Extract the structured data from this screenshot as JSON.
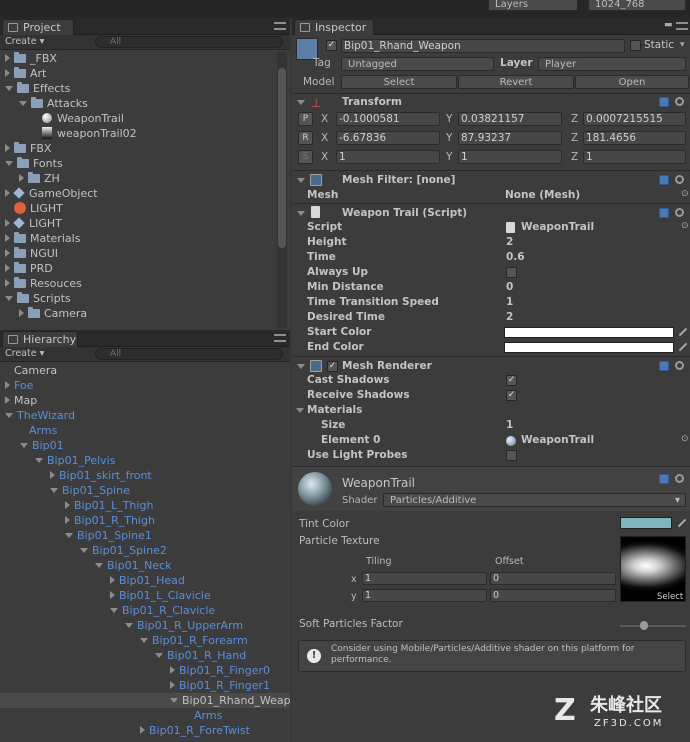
{
  "topbar": {
    "layers_label": "Layers",
    "layout_label": "1024_768"
  },
  "project": {
    "tab_label": "Project",
    "create_label": "Create ▾",
    "search_placeholder": "All",
    "items": [
      {
        "label": "_FBX",
        "depth": 0,
        "kind": "folder",
        "expand": "closed"
      },
      {
        "label": "Art",
        "depth": 0,
        "kind": "folder",
        "expand": "closed"
      },
      {
        "label": "Effects",
        "depth": 0,
        "kind": "folder",
        "expand": "open"
      },
      {
        "label": "Attacks",
        "depth": 1,
        "kind": "folder",
        "expand": "open"
      },
      {
        "label": "WeaponTrail",
        "depth": 2,
        "kind": "material",
        "expand": "none"
      },
      {
        "label": "weaponTrail02",
        "depth": 2,
        "kind": "texture",
        "expand": "none"
      },
      {
        "label": "FBX",
        "depth": 0,
        "kind": "folder",
        "expand": "closed"
      },
      {
        "label": "Fonts",
        "depth": 0,
        "kind": "folder",
        "expand": "open"
      },
      {
        "label": "ZH",
        "depth": 1,
        "kind": "folder",
        "expand": "closed"
      },
      {
        "label": "GameObject",
        "depth": 0,
        "kind": "prefab",
        "expand": "closed"
      },
      {
        "label": "LIGHT",
        "depth": 0,
        "kind": "lighticon",
        "expand": "none"
      },
      {
        "label": "LIGHT",
        "depth": 0,
        "kind": "prefab",
        "expand": "closed"
      },
      {
        "label": "Materials",
        "depth": 0,
        "kind": "folder",
        "expand": "closed"
      },
      {
        "label": "NGUI",
        "depth": 0,
        "kind": "folder",
        "expand": "closed"
      },
      {
        "label": "PRD",
        "depth": 0,
        "kind": "folder",
        "expand": "closed"
      },
      {
        "label": "Resouces",
        "depth": 0,
        "kind": "folder",
        "expand": "closed"
      },
      {
        "label": "Scripts",
        "depth": 0,
        "kind": "folder",
        "expand": "open"
      },
      {
        "label": "Camera",
        "depth": 1,
        "kind": "folder",
        "expand": "closed"
      }
    ]
  },
  "hierarchy": {
    "tab_label": "Hierarchy",
    "create_label": "Create ▾",
    "search_placeholder": "All",
    "items": [
      {
        "label": "Camera",
        "depth": 0,
        "expand": "none",
        "blue": false,
        "selected": false
      },
      {
        "label": "Foe",
        "depth": 0,
        "expand": "closed",
        "blue": true,
        "selected": false
      },
      {
        "label": "Map",
        "depth": 0,
        "expand": "closed",
        "blue": false,
        "selected": false
      },
      {
        "label": "TheWizard",
        "depth": 0,
        "expand": "open",
        "blue": true,
        "selected": false
      },
      {
        "label": "Arms",
        "depth": 1,
        "expand": "none",
        "blue": true,
        "selected": false
      },
      {
        "label": "Bip01",
        "depth": 1,
        "expand": "open",
        "blue": true,
        "selected": false
      },
      {
        "label": "Bip01_Pelvis",
        "depth": 2,
        "expand": "open",
        "blue": true,
        "selected": false
      },
      {
        "label": "Bip01_skirt_front",
        "depth": 3,
        "expand": "closed",
        "blue": true,
        "selected": false
      },
      {
        "label": "Bip01_Spine",
        "depth": 3,
        "expand": "open",
        "blue": true,
        "selected": false
      },
      {
        "label": "Bip01_L_Thigh",
        "depth": 4,
        "expand": "closed",
        "blue": true,
        "selected": false
      },
      {
        "label": "Bip01_R_Thigh",
        "depth": 4,
        "expand": "closed",
        "blue": true,
        "selected": false
      },
      {
        "label": "Bip01_Spine1",
        "depth": 4,
        "expand": "open",
        "blue": true,
        "selected": false
      },
      {
        "label": "Bip01_Spine2",
        "depth": 5,
        "expand": "open",
        "blue": true,
        "selected": false
      },
      {
        "label": "Bip01_Neck",
        "depth": 6,
        "expand": "open",
        "blue": true,
        "selected": false
      },
      {
        "label": "Bip01_Head",
        "depth": 7,
        "expand": "closed",
        "blue": true,
        "selected": false
      },
      {
        "label": "Bip01_L_Clavicle",
        "depth": 7,
        "expand": "closed",
        "blue": true,
        "selected": false
      },
      {
        "label": "Bip01_R_Clavicle",
        "depth": 7,
        "expand": "open",
        "blue": true,
        "selected": false
      },
      {
        "label": "Bip01_R_UpperArm",
        "depth": 8,
        "expand": "open",
        "blue": true,
        "selected": false
      },
      {
        "label": "Bip01_R_Forearm",
        "depth": 9,
        "expand": "open",
        "blue": true,
        "selected": false
      },
      {
        "label": "Bip01_R_Hand",
        "depth": 10,
        "expand": "open",
        "blue": true,
        "selected": false
      },
      {
        "label": "Bip01_R_Finger0",
        "depth": 11,
        "expand": "closed",
        "blue": true,
        "selected": false
      },
      {
        "label": "Bip01_R_Finger1",
        "depth": 11,
        "expand": "closed",
        "blue": true,
        "selected": false
      },
      {
        "label": "Bip01_Rhand_Weap",
        "depth": 11,
        "expand": "open",
        "blue": false,
        "selected": true
      },
      {
        "label": "Arms",
        "depth": 12,
        "expand": "none",
        "blue": true,
        "selected": false
      },
      {
        "label": "Bip01_R_ForeTwist",
        "depth": 9,
        "expand": "closed",
        "blue": true,
        "selected": false
      }
    ]
  },
  "inspector": {
    "tab_label": "Inspector",
    "object_name": "Bip01_Rhand_Weapon",
    "static_label": "Static",
    "tag_label": "Tag",
    "tag_value": "Untagged",
    "layer_label": "Layer",
    "layer_value": "Player",
    "model_label": "Model",
    "model_select": "Select",
    "model_revert": "Revert",
    "model_open": "Open",
    "transform": {
      "title": "Transform",
      "position": {
        "btn": "P",
        "x": "-0.1000581",
        "y": "0.03821157",
        "z": "0.0007215515"
      },
      "rotation": {
        "btn": "R",
        "x": "-6.67836",
        "y": "87.93237",
        "z": "181.4656"
      },
      "scale": {
        "btn": "S",
        "x": "1",
        "y": "1",
        "z": "1"
      },
      "x_label": "X",
      "y_label": "Y",
      "z_label": "Z"
    },
    "mesh_filter": {
      "title": "Mesh Filter: [none]",
      "mesh_label": "Mesh",
      "mesh_value": "None (Mesh)"
    },
    "weapon_trail": {
      "title": "Weapon Trail (Script)",
      "script_label": "Script",
      "script_value": "WeaponTrail",
      "height_label": "Height",
      "height_value": "2",
      "time_label": "Time",
      "time_value": "0.6",
      "always_up_label": "Always Up",
      "min_distance_label": "Min Distance",
      "min_distance_value": "0",
      "tts_label": "Time Transition Speed",
      "tts_value": "1",
      "desired_time_label": "Desired Time",
      "desired_time_value": "2",
      "start_color_label": "Start Color",
      "end_color_label": "End Color"
    },
    "mesh_renderer": {
      "title": "Mesh Renderer",
      "cast_shadows_label": "Cast Shadows",
      "receive_shadows_label": "Receive Shadows",
      "materials_label": "Materials",
      "size_label": "Size",
      "size_value": "1",
      "element0_label": "Element 0",
      "element0_value": "WeaponTrail",
      "light_probes_label": "Use Light Probes"
    },
    "material": {
      "name": "WeaponTrail",
      "shader_label": "Shader",
      "shader_value": "Particles/Additive",
      "tint_label": "Tint Color",
      "texture_label": "Particle Texture",
      "tiling_label": "Tiling",
      "offset_label": "Offset",
      "x_label": "x",
      "y_label": "y",
      "tiling_x": "1",
      "tiling_y": "1",
      "offset_x": "0",
      "offset_y": "0",
      "select_label": "Select",
      "soft_label": "Soft Particles Factor",
      "soft_value": 0.3,
      "info": "Consider using Mobile/Particles/Additive shader on this platform for performance."
    }
  },
  "watermark": {
    "brand": "朱峰社区",
    "url": "ZF3D.COM"
  },
  "colors": {
    "accent_blue": "#5b8fd6",
    "panel_bg": "#3c3c3c",
    "tint_color": "#7fb5bd"
  }
}
